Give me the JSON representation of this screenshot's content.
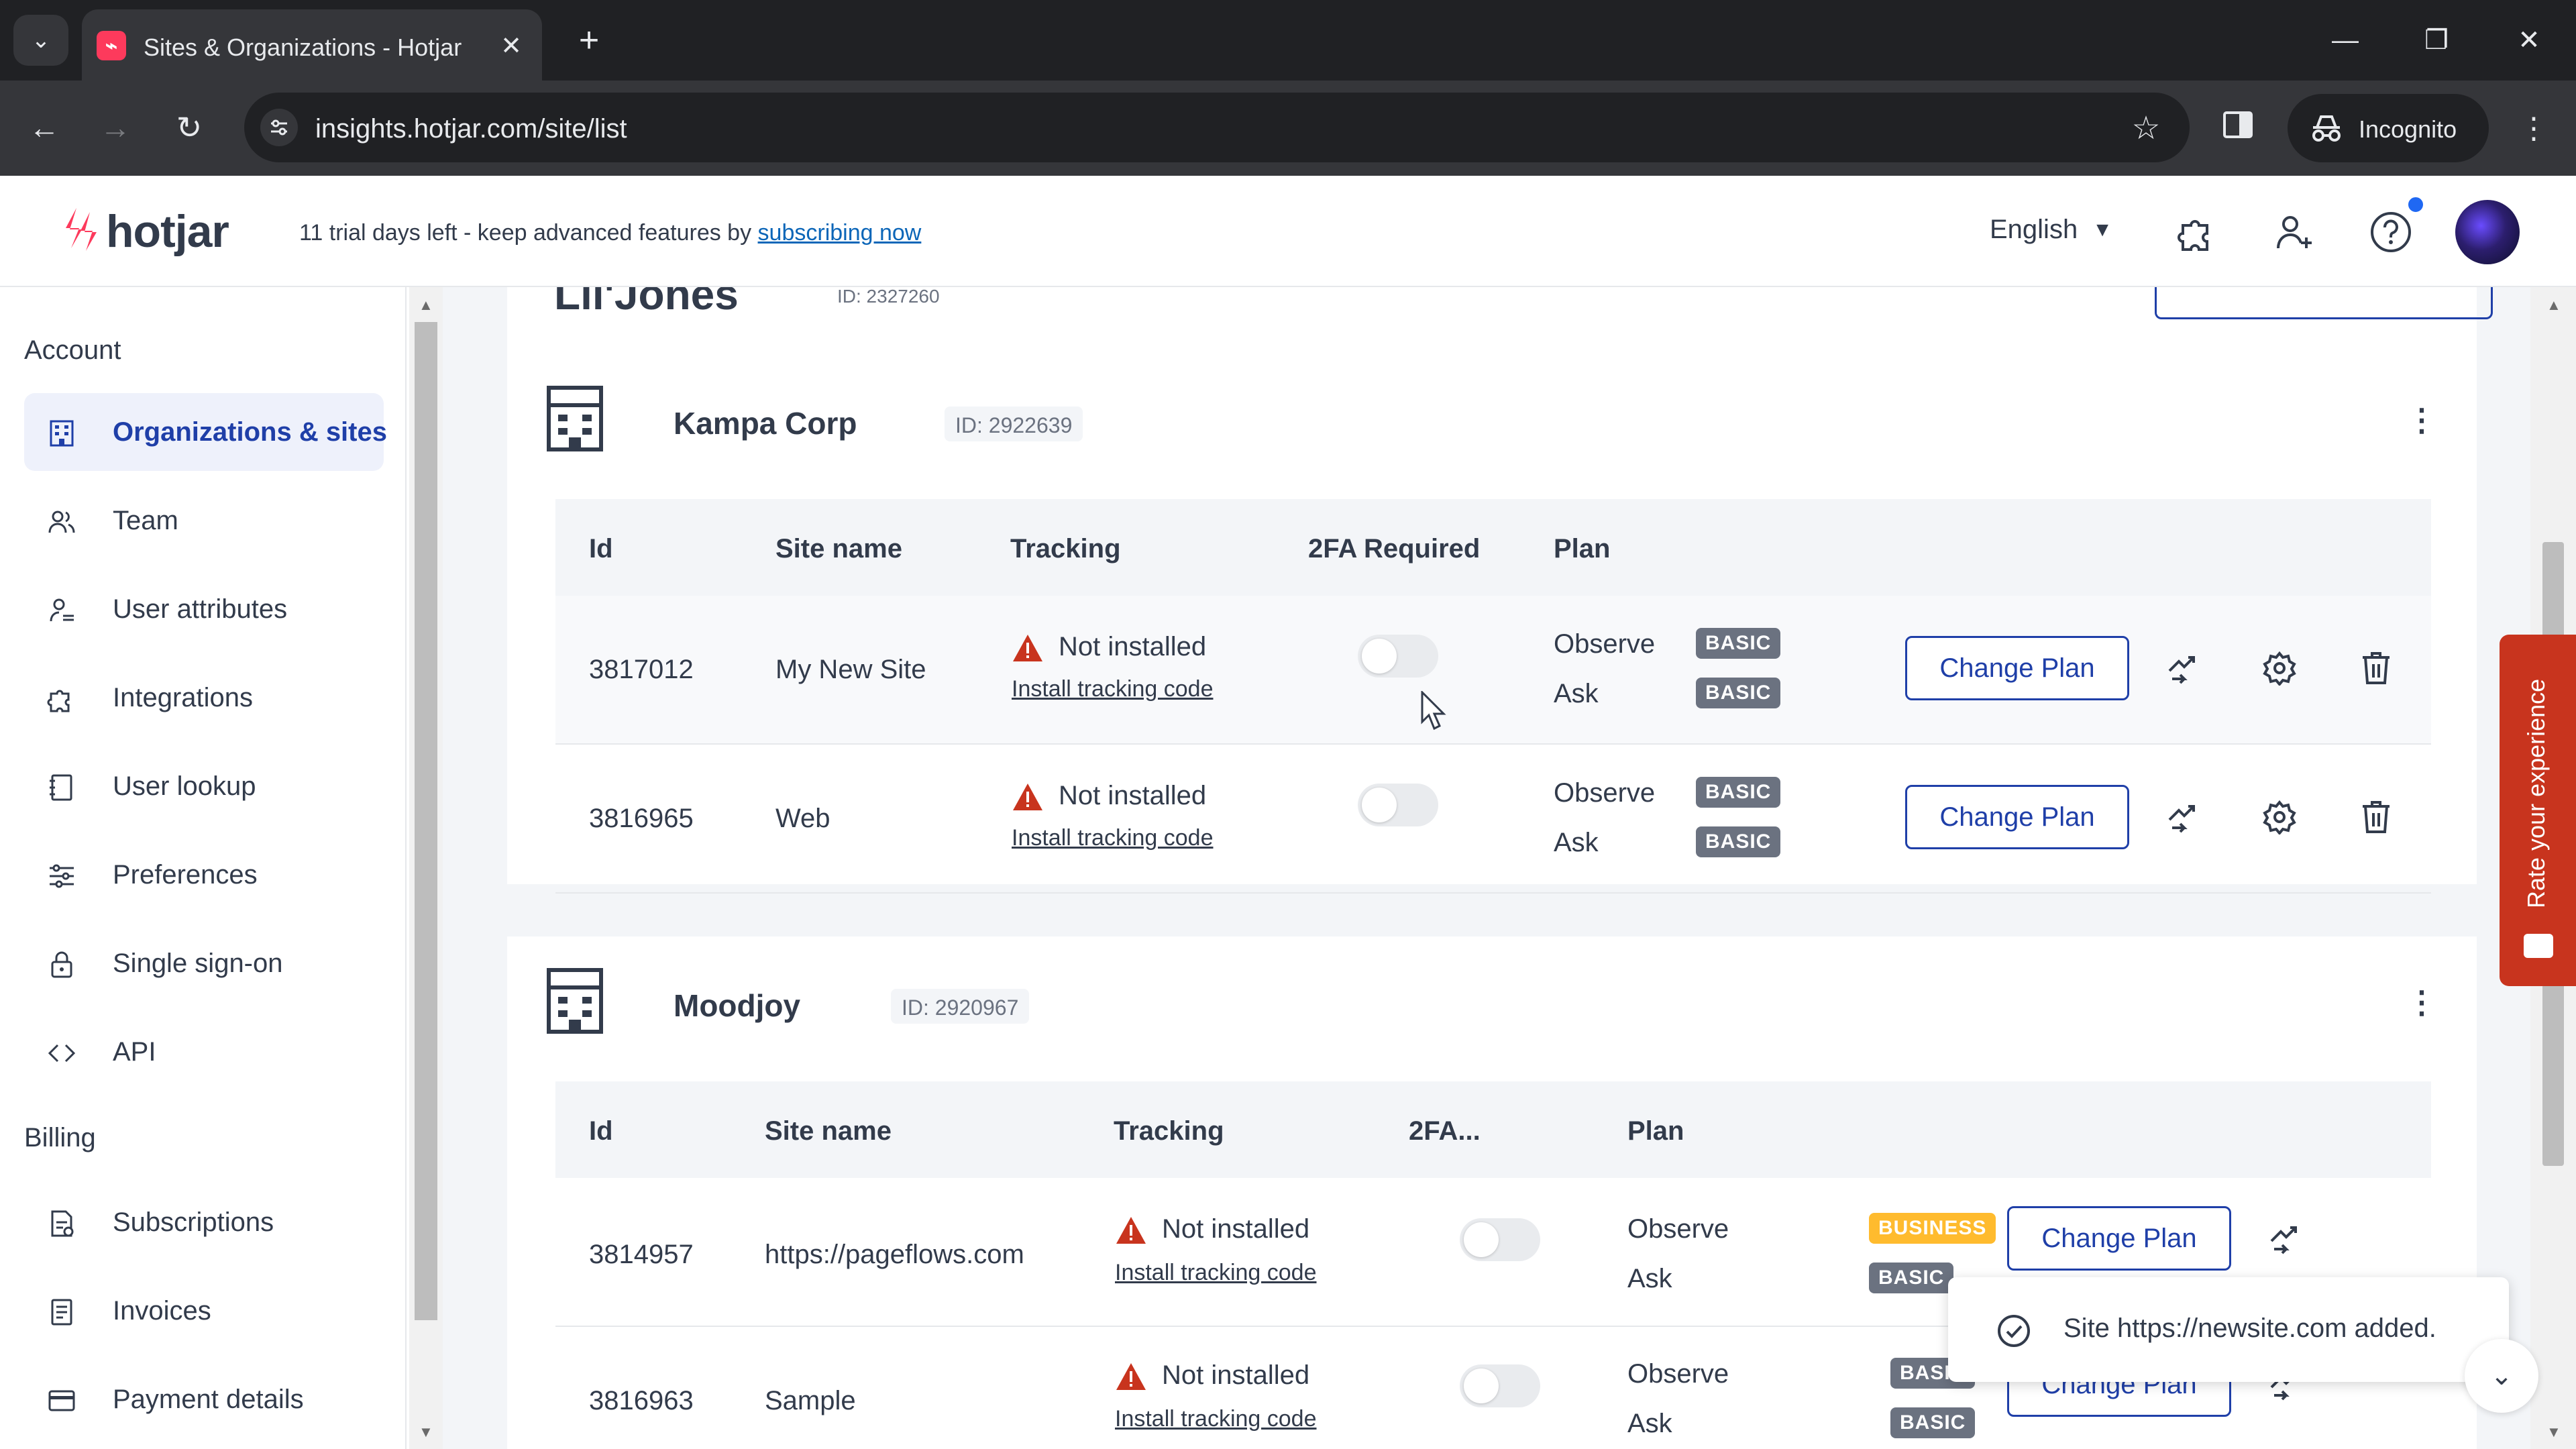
{
  "browser": {
    "tab_title": "Sites & Organizations - Hotjar",
    "url": "insights.hotjar.com/site/list",
    "incognito_label": "Incognito"
  },
  "header": {
    "logo_text": "hotjar",
    "trial_text": "11 trial days left - keep advanced features by ",
    "trial_link": "subscribing now",
    "language": "English"
  },
  "sidebar": {
    "account_heading": "Account",
    "billing_heading": "Billing",
    "account_items": [
      {
        "label": "Organizations & sites",
        "icon": "organization-icon",
        "active": true
      },
      {
        "label": "Team",
        "icon": "team-icon"
      },
      {
        "label": "User attributes",
        "icon": "user-attributes-icon"
      },
      {
        "label": "Integrations",
        "icon": "puzzle-icon"
      },
      {
        "label": "User lookup",
        "icon": "user-lookup-icon"
      },
      {
        "label": "Preferences",
        "icon": "sliders-icon"
      },
      {
        "label": "Single sign-on",
        "icon": "lock-icon"
      },
      {
        "label": "API",
        "icon": "code-icon"
      }
    ],
    "billing_items": [
      {
        "label": "Subscriptions",
        "icon": "subscriptions-icon"
      },
      {
        "label": "Invoices",
        "icon": "invoice-icon"
      },
      {
        "label": "Payment details",
        "icon": "credit-card-icon"
      }
    ]
  },
  "top_stub": {
    "title": "Lil'Jones",
    "id": "ID: 2327260"
  },
  "orgs": [
    {
      "name": "Kampa Corp",
      "id": "ID: 2922639",
      "columns": [
        "Id",
        "Site name",
        "Tracking",
        "2FA Required",
        "Plan"
      ],
      "rows": [
        {
          "id": "3817012",
          "site": "My New Site",
          "status": "Not installed",
          "install": "Install tracking code",
          "observe": "Observe",
          "observe_plan": "BASIC",
          "ask": "Ask",
          "ask_plan": "BASIC",
          "button": "Change Plan"
        },
        {
          "id": "3816965",
          "site": "Web",
          "status": "Not installed",
          "install": "Install tracking code",
          "observe": "Observe",
          "observe_plan": "BASIC",
          "ask": "Ask",
          "ask_plan": "BASIC",
          "button": "Change Plan"
        }
      ]
    },
    {
      "name": "Moodjoy",
      "id": "ID: 2920967",
      "columns": [
        "Id",
        "Site name",
        "Tracking",
        "2FA...",
        "Plan"
      ],
      "rows": [
        {
          "id": "3814957",
          "site": "https://pageflows.com",
          "status": "Not installed",
          "install": "Install tracking code",
          "observe": "Observe",
          "observe_plan": "BUSINESS",
          "ask": "Ask",
          "ask_plan": "BASIC",
          "button": "Change Plan"
        },
        {
          "id": "3816963",
          "site": "Sample",
          "status": "Not installed",
          "install": "Install tracking code",
          "observe": "Observe",
          "observe_plan": "BASIC",
          "ask": "Ask",
          "ask_plan": "BASIC",
          "button": "Change Plan"
        }
      ]
    }
  ],
  "feedback_tab": "Rate your experience",
  "toast": "Site https://newsite.com added.",
  "colors": {
    "brand": "#fd3a5c",
    "primary": "#1f3fa8",
    "feedback": "#c8341e",
    "business": "#ffbb2e"
  }
}
